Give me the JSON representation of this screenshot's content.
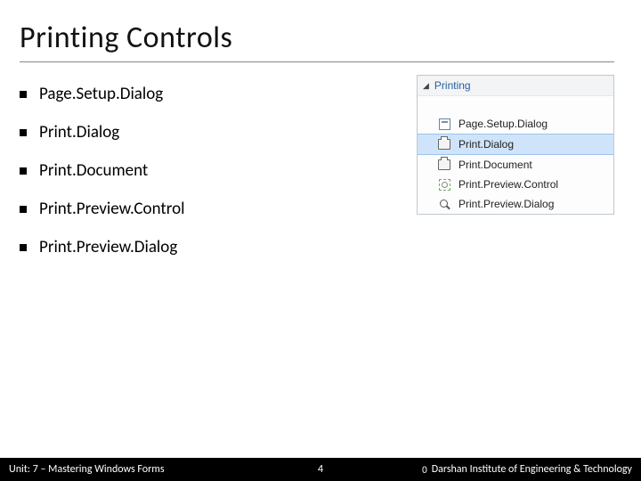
{
  "title": "Printing Controls",
  "bullets": [
    "Page.Setup.Dialog",
    "Print.Dialog",
    "Print.Document",
    "Print.Preview.Control",
    "Print.Preview.Dialog"
  ],
  "toolbox": {
    "category": "Printing",
    "items": [
      {
        "label": "Page.Setup.Dialog",
        "icon": "pagesetup-icon"
      },
      {
        "label": "Print.Dialog",
        "icon": "print-icon",
        "selected": true
      },
      {
        "label": "Print.Document",
        "icon": "print-icon"
      },
      {
        "label": "Print.Preview.Control",
        "icon": "preview-icon"
      },
      {
        "label": "Print.Preview.Dialog",
        "icon": "magnifier-icon"
      }
    ]
  },
  "footer": {
    "unit": "Unit: 7 – Mastering Windows Forms",
    "page": "4",
    "institute_prefix": "0",
    "institute": "Darshan Institute of Engineering & Technology"
  }
}
